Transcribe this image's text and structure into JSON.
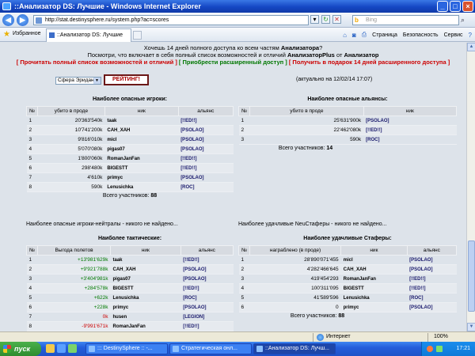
{
  "window": {
    "title": "::Анализатор DS: Лучшие - Windows Internet Explorer"
  },
  "browser": {
    "url": "http://stat.destinysphere.ru/system.php?ac=scores",
    "search_placeholder": "Bing",
    "favorites": "Избранное",
    "tab_title": "::Анализатор DS: Лучшие",
    "cmd": {
      "page": "Страница",
      "security": "Безопасность",
      "service": "Сервис"
    }
  },
  "promo": {
    "line1_pre": "Хочешь 14 дней полного доступа ко всем частям ",
    "line1_bold": "Анализатора",
    "line1_post": "?",
    "line2_pre": "Посмотри, что включает в себя полный список возможностей и отличий ",
    "line2_b1": "АнализаторPlus",
    "line2_mid": " от ",
    "line2_b2": "Анализатор",
    "link1": "[ Прочитать полный список возможностей и отличий ]",
    "link2": "[ Приобрести расширенный доступ ]",
    "link3": "[ Получить в подарок 14 дней расширенного доступа ]"
  },
  "controls": {
    "sphere_select": "Сфера Эридана",
    "rating_button": "РЕЙТИНГ!",
    "updated": "(актуально на 12/02/14 17:07)"
  },
  "players": {
    "title": "Наиболее опасные игроки:",
    "cols": [
      "№",
      "убито в проде",
      "ник",
      "альянс"
    ],
    "rows": [
      [
        "1",
        "20'363'540k",
        "taak",
        "[!!ED!!]"
      ],
      [
        "2",
        "10'741'200k",
        "CAH_XAH",
        "[PSOLAO]"
      ],
      [
        "3",
        "9'816'010k",
        "micl",
        "[PSOLAO]"
      ],
      [
        "4",
        "5'070'080k",
        "pigas07",
        "[PSOLAO]"
      ],
      [
        "5",
        "1'800'060k",
        "RomanJanFan",
        "[!!ED!!]"
      ],
      [
        "6",
        "298'480k",
        "BIGESTT",
        "[!!ED!!]"
      ],
      [
        "7",
        "4'610k",
        "primyc",
        "[PSOLAO]"
      ],
      [
        "8",
        "590k",
        "Lenusichka",
        "[ROC]"
      ]
    ],
    "total_label": "Всего участников:",
    "total": "88"
  },
  "alliances": {
    "title": "Наиболее опасные альянсы:",
    "cols": [
      "№",
      "убито в проде",
      "ник"
    ],
    "rows": [
      [
        "1",
        "25'631'900k",
        "[PSOLAO]"
      ],
      [
        "2",
        "22'462'080k",
        "[!!ED!!]"
      ],
      [
        "3",
        "590k",
        "[ROC]"
      ]
    ],
    "total_label": "Всего участников:",
    "total": "14"
  },
  "neutral_heading": "Наиболее опасные игроки-нейтралы - никого не найдено...",
  "lucky_heading": "Наиболее удачливые NeuСтаферы - никого не найдено...",
  "tactical": {
    "title": "Наиболее тактические:",
    "cols": [
      "№",
      "Выгода полетов",
      "ник",
      "альянс"
    ],
    "rows": [
      [
        "1",
        "+13'981'629k",
        "taak",
        "[!!ED!!]",
        "pos"
      ],
      [
        "2",
        "+9'921'788k",
        "CAH_XAH",
        "[PSOLAO]",
        "pos"
      ],
      [
        "3",
        "+3'404'981k",
        "pigas07",
        "[PSOLAO]",
        "pos"
      ],
      [
        "4",
        "+284'578k",
        "BIGESTT",
        "[!!ED!!]",
        "pos"
      ],
      [
        "5",
        "+622k",
        "Lenusichka",
        "[ROC]",
        "pos"
      ],
      [
        "6",
        "+228k",
        "primyc",
        "[PSOLAO]",
        "pos"
      ],
      [
        "7",
        "0k",
        "husen",
        "[LEGION]",
        "neg"
      ],
      [
        "8",
        "-9'991'671k",
        "RomanJanFan",
        "[!!ED!!]",
        "neg"
      ]
    ]
  },
  "stafers": {
    "title": "Наиболее удачливые Стаферы:",
    "cols": [
      "№",
      "награблено (в проде)",
      "ник",
      "альянс"
    ],
    "rows": [
      [
        "1",
        "28'890'071'455",
        "micl",
        "[PSOLAO]"
      ],
      [
        "2",
        "4'282'466'645",
        "CAH_XAH",
        "[PSOLAO]"
      ],
      [
        "3",
        "419'454'293",
        "RomanJanFan",
        "[!!ED!!]"
      ],
      [
        "4",
        "100'311'095",
        "BIGESTT",
        "[!!ED!!]"
      ],
      [
        "5",
        "41'589'596",
        "Lenusichka",
        "[ROC]"
      ],
      [
        "6",
        "0",
        "primyc",
        "[PSOLAO]"
      ]
    ],
    "total_label": "Всего участников:",
    "total": "88"
  },
  "statusbar": {
    "zone": "Интернет",
    "zoom": "100%"
  },
  "taskbar": {
    "start": "пуск",
    "buttons": [
      "::: DestinySphere :: -...",
      "Стратегическая онл...",
      "::Анализатор DS: Лучш..."
    ],
    "lang": "EN",
    "clock": "17:21"
  }
}
